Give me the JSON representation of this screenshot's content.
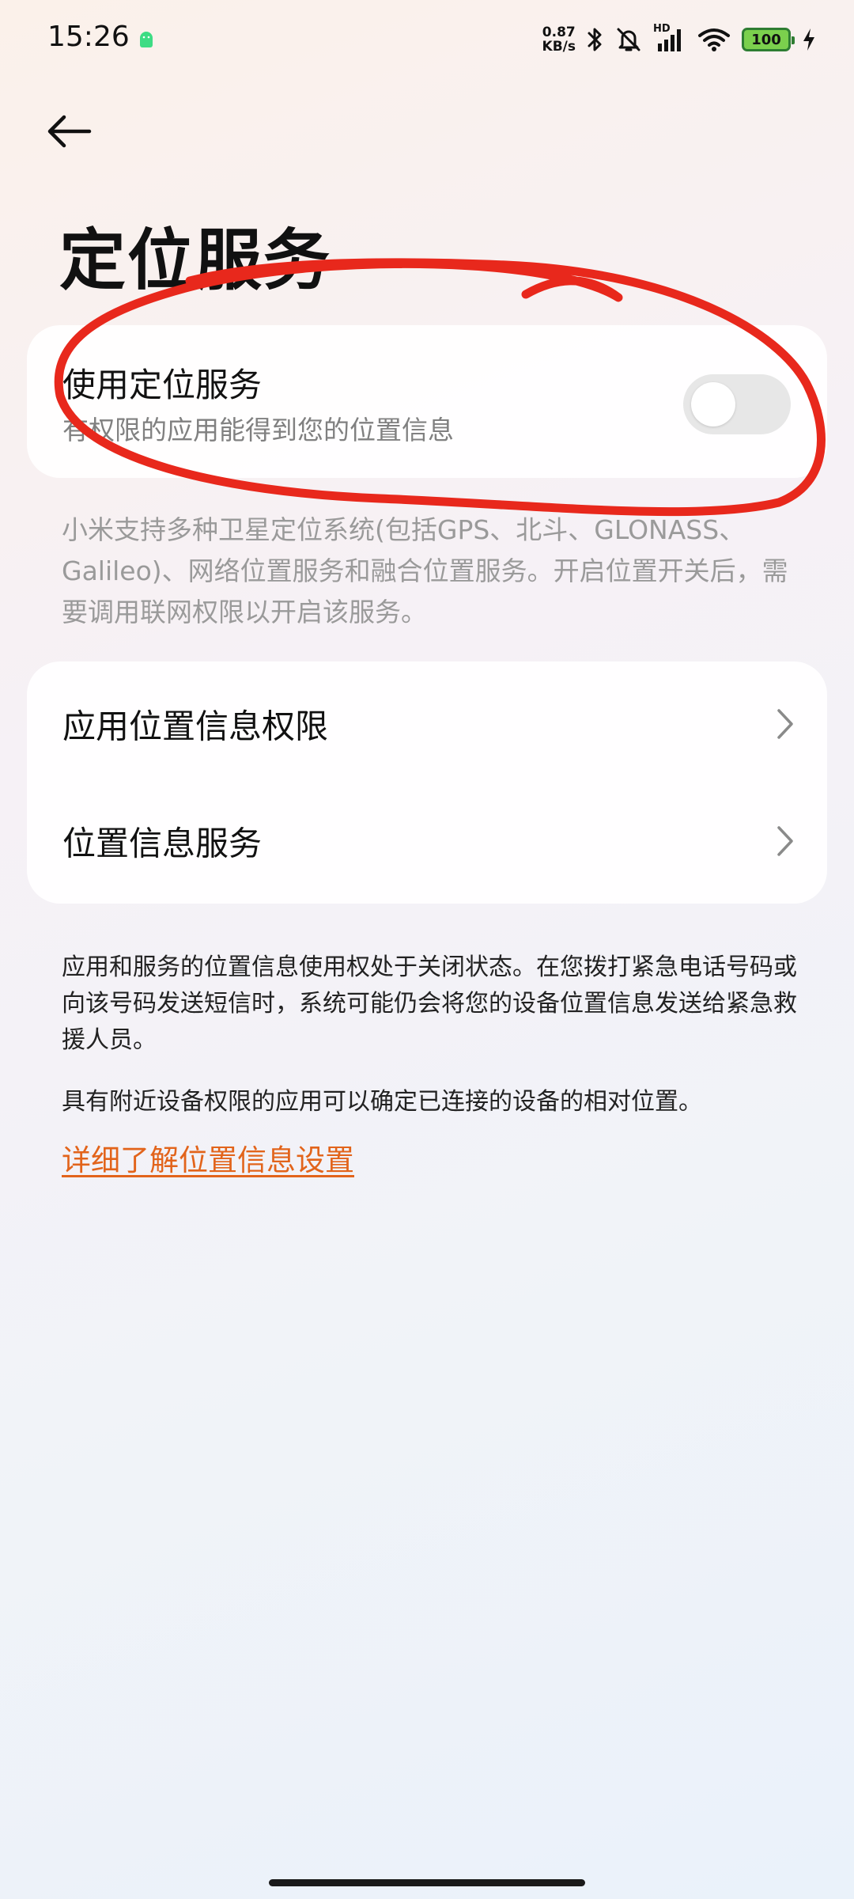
{
  "status_bar": {
    "time": "15:26",
    "net_speed_value": "0.87",
    "net_speed_unit": "KB/s",
    "signal_label": "HD",
    "battery_level": "100",
    "icons": [
      "android-icon",
      "bluetooth-icon",
      "mute-bell-icon",
      "signal-icon",
      "wifi-icon",
      "battery-icon",
      "charging-icon"
    ]
  },
  "header": {
    "back_icon": "arrow-left-icon",
    "title": "定位服务"
  },
  "location_card": {
    "title": "使用定位服务",
    "subtitle": "有权限的应用能得到您的位置信息",
    "toggle_on": false
  },
  "location_description": "小米支持多种卫星定位系统(包括GPS、北斗、GLONASS、Galileo)、网络位置服务和融合位置服务。开启位置开关后，需要调用联网权限以开启该服务。",
  "menu": {
    "items": [
      {
        "label": "应用位置信息权限",
        "icon": "chevron-right-icon"
      },
      {
        "label": "位置信息服务",
        "icon": "chevron-right-icon"
      }
    ]
  },
  "info": {
    "emergency_note": "应用和服务的位置信息使用权处于关闭状态。在您拨打紧急电话号码或向该号码发送短信时，系统可能仍会将您的设备位置信息发送给紧急救援人员。",
    "nearby_note": "具有附近设备权限的应用可以确定已连接的设备的相对位置。",
    "learn_more_link": "详细了解位置信息设置"
  },
  "colors": {
    "accent_link": "#e2641b",
    "annotation_stroke": "#e8281c",
    "toggle_off": "#e7e7e7",
    "battery_fill": "#7bd04d"
  }
}
